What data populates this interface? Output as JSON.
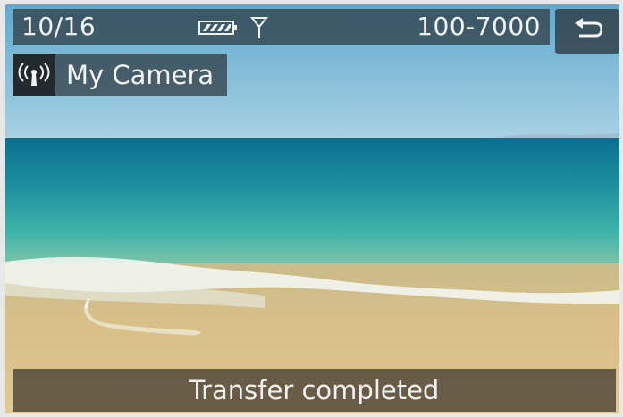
{
  "header": {
    "image_counter": "10/16",
    "battery_icon": "battery-icon",
    "signal_icon": "antenna-icon",
    "file_number": "100-7000"
  },
  "back_button": {
    "icon": "return-arrow-icon"
  },
  "connection": {
    "icon": "wifi-icon",
    "device_name": "My Camera"
  },
  "status": {
    "message": "Transfer completed"
  },
  "colors": {
    "overlay": "#2d373e",
    "status_overlay": "#463e32",
    "text": "#f2f2f2",
    "sky": "#7fb9d6",
    "sea": "#2fa3a3",
    "sand": "#d7c38f"
  }
}
